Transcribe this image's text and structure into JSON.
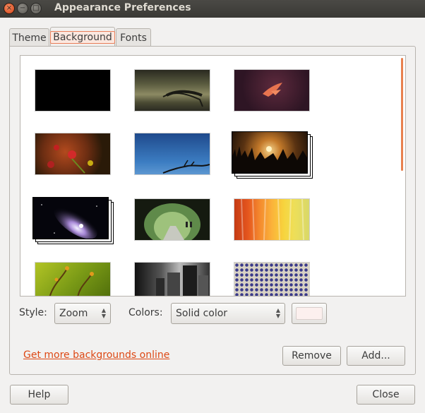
{
  "window": {
    "title": "Appearance Preferences",
    "controls": [
      "close-icon",
      "minimize-icon",
      "maximize-icon"
    ]
  },
  "tabs": [
    {
      "label": "Theme",
      "active": false
    },
    {
      "label": "Background",
      "active": true
    },
    {
      "label": "Fonts",
      "active": false
    }
  ],
  "options": {
    "style_label": "Style:",
    "style_value": "Zoom",
    "colors_label": "Colors:",
    "colors_value": "Solid color",
    "color_swatch": "#fcf0ee"
  },
  "links": {
    "more_backgrounds": "Get more backgrounds online"
  },
  "buttons": {
    "remove": "Remove",
    "add": "Add...",
    "help": "Help",
    "close": "Close"
  },
  "colors": {
    "accent": "#dd4814",
    "selection": "#e87e59",
    "titlebar": "#3c3b37"
  }
}
